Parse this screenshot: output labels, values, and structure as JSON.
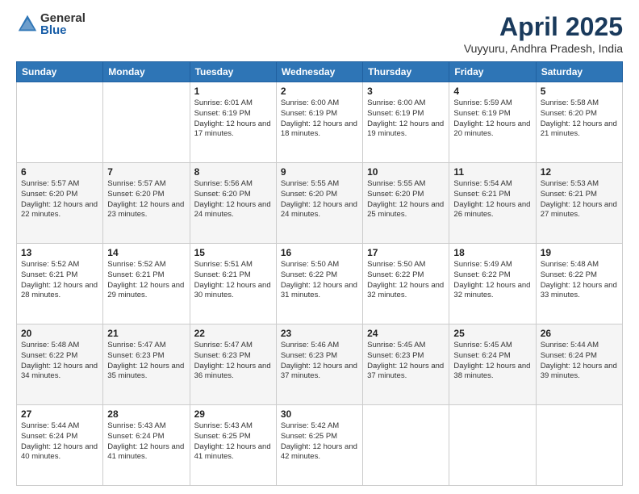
{
  "logo": {
    "general": "General",
    "blue": "Blue"
  },
  "title": "April 2025",
  "subtitle": "Vuyyuru, Andhra Pradesh, India",
  "weekdays": [
    "Sunday",
    "Monday",
    "Tuesday",
    "Wednesday",
    "Thursday",
    "Friday",
    "Saturday"
  ],
  "weeks": [
    [
      {
        "day": "",
        "info": ""
      },
      {
        "day": "",
        "info": ""
      },
      {
        "day": "1",
        "info": "Sunrise: 6:01 AM\nSunset: 6:19 PM\nDaylight: 12 hours and 17 minutes."
      },
      {
        "day": "2",
        "info": "Sunrise: 6:00 AM\nSunset: 6:19 PM\nDaylight: 12 hours and 18 minutes."
      },
      {
        "day": "3",
        "info": "Sunrise: 6:00 AM\nSunset: 6:19 PM\nDaylight: 12 hours and 19 minutes."
      },
      {
        "day": "4",
        "info": "Sunrise: 5:59 AM\nSunset: 6:19 PM\nDaylight: 12 hours and 20 minutes."
      },
      {
        "day": "5",
        "info": "Sunrise: 5:58 AM\nSunset: 6:20 PM\nDaylight: 12 hours and 21 minutes."
      }
    ],
    [
      {
        "day": "6",
        "info": "Sunrise: 5:57 AM\nSunset: 6:20 PM\nDaylight: 12 hours and 22 minutes."
      },
      {
        "day": "7",
        "info": "Sunrise: 5:57 AM\nSunset: 6:20 PM\nDaylight: 12 hours and 23 minutes."
      },
      {
        "day": "8",
        "info": "Sunrise: 5:56 AM\nSunset: 6:20 PM\nDaylight: 12 hours and 24 minutes."
      },
      {
        "day": "9",
        "info": "Sunrise: 5:55 AM\nSunset: 6:20 PM\nDaylight: 12 hours and 24 minutes."
      },
      {
        "day": "10",
        "info": "Sunrise: 5:55 AM\nSunset: 6:20 PM\nDaylight: 12 hours and 25 minutes."
      },
      {
        "day": "11",
        "info": "Sunrise: 5:54 AM\nSunset: 6:21 PM\nDaylight: 12 hours and 26 minutes."
      },
      {
        "day": "12",
        "info": "Sunrise: 5:53 AM\nSunset: 6:21 PM\nDaylight: 12 hours and 27 minutes."
      }
    ],
    [
      {
        "day": "13",
        "info": "Sunrise: 5:52 AM\nSunset: 6:21 PM\nDaylight: 12 hours and 28 minutes."
      },
      {
        "day": "14",
        "info": "Sunrise: 5:52 AM\nSunset: 6:21 PM\nDaylight: 12 hours and 29 minutes."
      },
      {
        "day": "15",
        "info": "Sunrise: 5:51 AM\nSunset: 6:21 PM\nDaylight: 12 hours and 30 minutes."
      },
      {
        "day": "16",
        "info": "Sunrise: 5:50 AM\nSunset: 6:22 PM\nDaylight: 12 hours and 31 minutes."
      },
      {
        "day": "17",
        "info": "Sunrise: 5:50 AM\nSunset: 6:22 PM\nDaylight: 12 hours and 32 minutes."
      },
      {
        "day": "18",
        "info": "Sunrise: 5:49 AM\nSunset: 6:22 PM\nDaylight: 12 hours and 32 minutes."
      },
      {
        "day": "19",
        "info": "Sunrise: 5:48 AM\nSunset: 6:22 PM\nDaylight: 12 hours and 33 minutes."
      }
    ],
    [
      {
        "day": "20",
        "info": "Sunrise: 5:48 AM\nSunset: 6:22 PM\nDaylight: 12 hours and 34 minutes."
      },
      {
        "day": "21",
        "info": "Sunrise: 5:47 AM\nSunset: 6:23 PM\nDaylight: 12 hours and 35 minutes."
      },
      {
        "day": "22",
        "info": "Sunrise: 5:47 AM\nSunset: 6:23 PM\nDaylight: 12 hours and 36 minutes."
      },
      {
        "day": "23",
        "info": "Sunrise: 5:46 AM\nSunset: 6:23 PM\nDaylight: 12 hours and 37 minutes."
      },
      {
        "day": "24",
        "info": "Sunrise: 5:45 AM\nSunset: 6:23 PM\nDaylight: 12 hours and 37 minutes."
      },
      {
        "day": "25",
        "info": "Sunrise: 5:45 AM\nSunset: 6:24 PM\nDaylight: 12 hours and 38 minutes."
      },
      {
        "day": "26",
        "info": "Sunrise: 5:44 AM\nSunset: 6:24 PM\nDaylight: 12 hours and 39 minutes."
      }
    ],
    [
      {
        "day": "27",
        "info": "Sunrise: 5:44 AM\nSunset: 6:24 PM\nDaylight: 12 hours and 40 minutes."
      },
      {
        "day": "28",
        "info": "Sunrise: 5:43 AM\nSunset: 6:24 PM\nDaylight: 12 hours and 41 minutes."
      },
      {
        "day": "29",
        "info": "Sunrise: 5:43 AM\nSunset: 6:25 PM\nDaylight: 12 hours and 41 minutes."
      },
      {
        "day": "30",
        "info": "Sunrise: 5:42 AM\nSunset: 6:25 PM\nDaylight: 12 hours and 42 minutes."
      },
      {
        "day": "",
        "info": ""
      },
      {
        "day": "",
        "info": ""
      },
      {
        "day": "",
        "info": ""
      }
    ]
  ]
}
